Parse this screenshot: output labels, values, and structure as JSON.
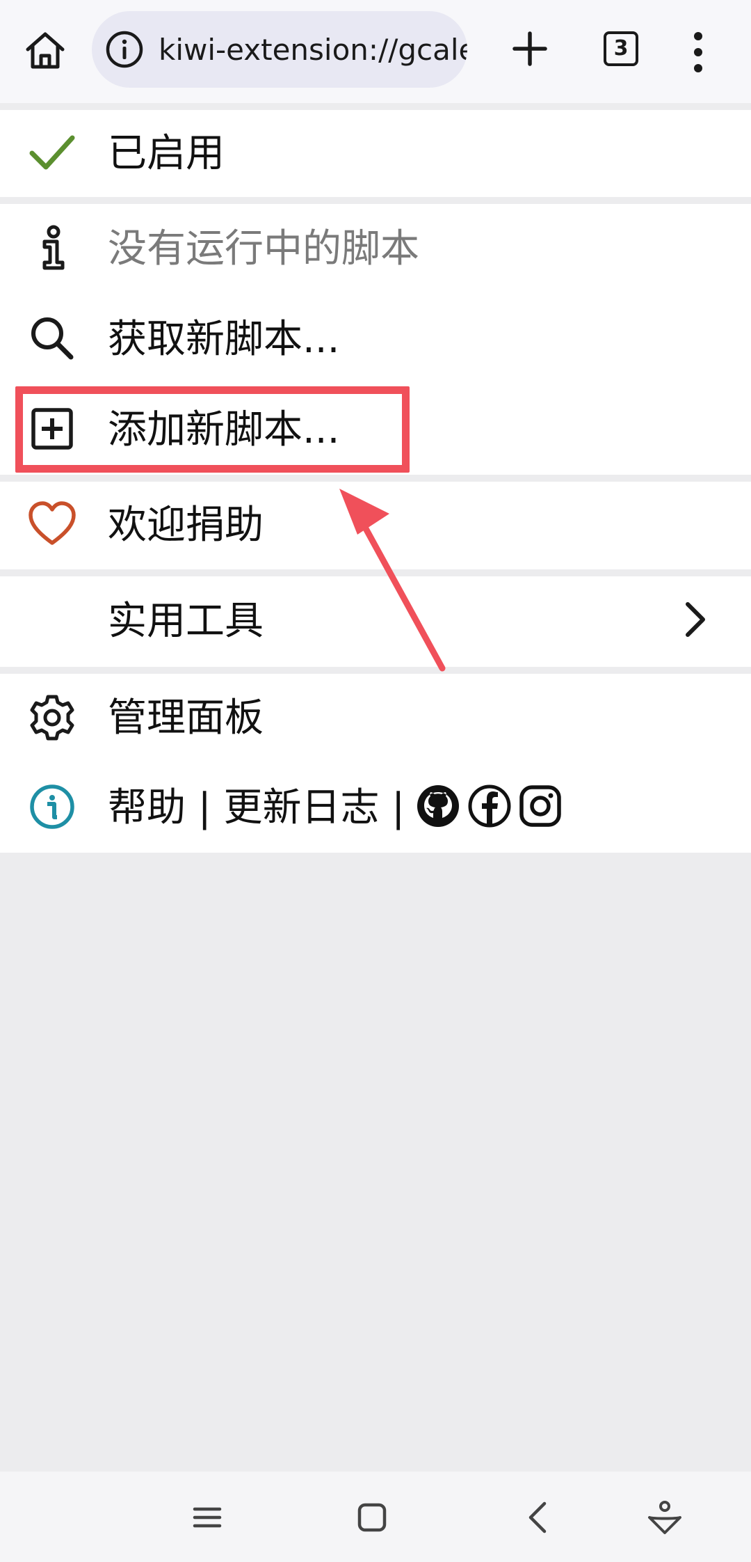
{
  "browser": {
    "url_text": "kiwi-extension://gcale",
    "tab_count": "3"
  },
  "menu": {
    "enabled_label": "已启用",
    "no_scripts_label": "没有运行中的脚本",
    "get_scripts_label": "获取新脚本...",
    "add_script_label": "添加新脚本...",
    "donate_label": "欢迎捐助",
    "utilities_label": "实用工具",
    "dashboard_label": "管理面板",
    "help_label": "帮助 | 更新日志 |"
  },
  "colors": {
    "check": "#5b8f2f",
    "heart": "#c9502a",
    "help_info": "#1e8fa5",
    "annotation": "#f0505a"
  },
  "icons": {
    "home": "home-icon",
    "info": "info-icon",
    "plus": "plus-icon",
    "menu": "more-vert-icon",
    "check": "check-icon",
    "search": "search-icon",
    "add_box": "add-box-icon",
    "heart": "heart-icon",
    "chevron": "chevron-right-icon",
    "gear": "gear-icon",
    "github": "github-icon",
    "facebook": "facebook-icon",
    "instagram": "instagram-icon"
  }
}
